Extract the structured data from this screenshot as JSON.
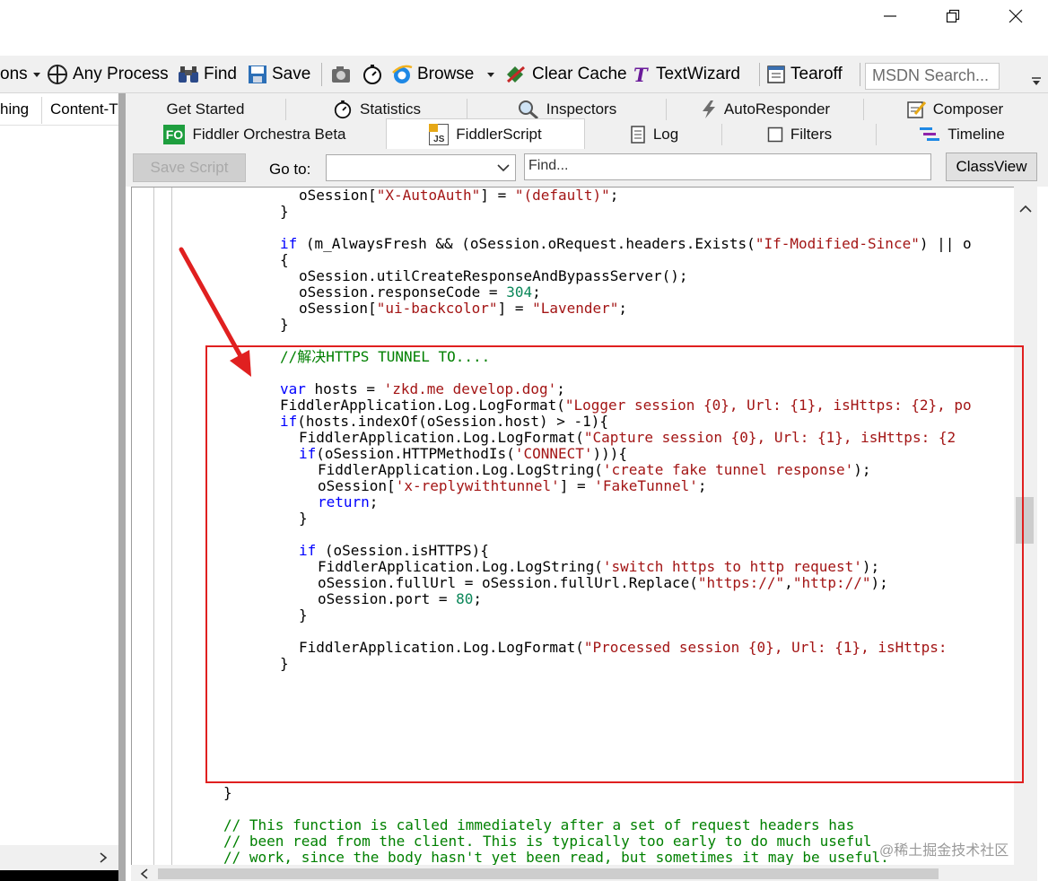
{
  "window": {
    "minimize_glyph": "—",
    "maximize_glyph": "❐",
    "close_glyph": "✕"
  },
  "toolbar": {
    "options_label": "ons",
    "any_process_label": "Any Process",
    "find_label": "Find",
    "save_label": "Save",
    "browse_label": "Browse",
    "clear_cache_label": "Clear Cache",
    "textwizard_label": "TextWizard",
    "tearoff_label": "Tearoff",
    "msdn_placeholder": "MSDN Search..."
  },
  "sessions": {
    "columns": [
      "hing",
      "Content-T"
    ]
  },
  "tabs": {
    "row1": [
      {
        "label": "Get Started",
        "icon": "none"
      },
      {
        "label": "Statistics",
        "icon": "stopwatch-icon"
      },
      {
        "label": "Inspectors",
        "icon": "inspectors-icon"
      },
      {
        "label": "AutoResponder",
        "icon": "lightning-icon"
      },
      {
        "label": "Composer",
        "icon": "composer-icon"
      }
    ],
    "row2": [
      {
        "label": "Fiddler Orchestra Beta",
        "icon": "fo-icon",
        "badge": "FO"
      },
      {
        "label": "FiddlerScript",
        "icon": "js-icon",
        "badge": "JS",
        "active": true
      },
      {
        "label": "Log",
        "icon": "log-icon"
      },
      {
        "label": "Filters",
        "icon": "checkbox-icon"
      },
      {
        "label": "Timeline",
        "icon": "timeline-icon"
      }
    ]
  },
  "script_toolbar": {
    "save_script_label": "Save Script",
    "goto_label": "Go to:",
    "find_placeholder": "Find...",
    "classview_label": "ClassView"
  },
  "code": [
    {
      "indent": 8,
      "tokens": [
        [
          "pl",
          "oSession["
        ],
        [
          "st",
          "\"X-AutoAuth\""
        ],
        [
          "pl",
          "] = "
        ],
        [
          "st",
          "\"(default)\""
        ],
        [
          "pl",
          ";"
        ]
      ]
    },
    {
      "indent": 4,
      "tokens": [
        [
          "pl",
          "}"
        ]
      ]
    },
    {
      "indent": 0,
      "tokens": []
    },
    {
      "indent": 4,
      "tokens": [
        [
          "kw",
          "if"
        ],
        [
          "pl",
          " (m_AlwaysFresh && (oSession.oRequest.headers.Exists("
        ],
        [
          "st",
          "\"If-Modified-Since\""
        ],
        [
          "pl",
          ") || o"
        ]
      ]
    },
    {
      "indent": 4,
      "tokens": [
        [
          "pl",
          "{"
        ]
      ]
    },
    {
      "indent": 8,
      "tokens": [
        [
          "pl",
          "oSession.utilCreateResponseAndBypassServer();"
        ]
      ]
    },
    {
      "indent": 8,
      "tokens": [
        [
          "pl",
          "oSession.responseCode = "
        ],
        [
          "nm",
          "304"
        ],
        [
          "pl",
          ";"
        ]
      ]
    },
    {
      "indent": 8,
      "tokens": [
        [
          "pl",
          "oSession["
        ],
        [
          "st",
          "\"ui-backcolor\""
        ],
        [
          "pl",
          "] = "
        ],
        [
          "st",
          "\"Lavender\""
        ],
        [
          "pl",
          ";"
        ]
      ]
    },
    {
      "indent": 4,
      "tokens": [
        [
          "pl",
          "}"
        ]
      ]
    },
    {
      "indent": 4,
      "tokens": [
        [
          "cm",
          "//解决HTTPS TUNNEL TO...."
        ]
      ]
    },
    {
      "indent": 0,
      "tokens": []
    },
    {
      "indent": 4,
      "tokens": [
        [
          "kw",
          "var"
        ],
        [
          "pl",
          " hosts = "
        ],
        [
          "st",
          "'zkd.me develop.dog'"
        ],
        [
          "pl",
          ";"
        ]
      ]
    },
    {
      "indent": 4,
      "tokens": [
        [
          "pl",
          "FiddlerApplication.Log.LogFormat("
        ],
        [
          "st",
          "\"Logger session {0}, Url: {1}, isHttps: {2}, po"
        ]
      ]
    },
    {
      "indent": 4,
      "tokens": [
        [
          "kw",
          "if"
        ],
        [
          "pl",
          "(hosts.indexOf(oSession.host) > -1){"
        ]
      ]
    },
    {
      "indent": 8,
      "tokens": [
        [
          "pl",
          "FiddlerApplication.Log.LogFormat("
        ],
        [
          "st",
          "\"Capture session {0}, Url: {1}, isHttps: {2"
        ]
      ]
    },
    {
      "indent": 8,
      "tokens": [
        [
          "kw",
          "if"
        ],
        [
          "pl",
          "(oSession.HTTPMethodIs("
        ],
        [
          "st",
          "'CONNECT'"
        ],
        [
          "pl",
          "))){"
        ]
      ]
    },
    {
      "indent": 12,
      "tokens": [
        [
          "pl",
          "FiddlerApplication.Log.LogString("
        ],
        [
          "st",
          "'create fake tunnel response'"
        ],
        [
          "pl",
          ");"
        ]
      ]
    },
    {
      "indent": 12,
      "tokens": [
        [
          "pl",
          "oSession["
        ],
        [
          "st",
          "'x-replywithtunnel'"
        ],
        [
          "pl",
          "] = "
        ],
        [
          "st",
          "'FakeTunnel'"
        ],
        [
          "pl",
          ";"
        ]
      ]
    },
    {
      "indent": 12,
      "tokens": [
        [
          "kw",
          "return"
        ],
        [
          "pl",
          ";"
        ]
      ]
    },
    {
      "indent": 8,
      "tokens": [
        [
          "pl",
          "}"
        ]
      ]
    },
    {
      "indent": 0,
      "tokens": []
    },
    {
      "indent": 8,
      "tokens": [
        [
          "kw",
          "if"
        ],
        [
          "pl",
          " (oSession.isHTTPS){"
        ]
      ]
    },
    {
      "indent": 12,
      "tokens": [
        [
          "pl",
          "FiddlerApplication.Log.LogString("
        ],
        [
          "st",
          "'switch https to http request'"
        ],
        [
          "pl",
          ");"
        ]
      ]
    },
    {
      "indent": 12,
      "tokens": [
        [
          "pl",
          "oSession.fullUrl = oSession.fullUrl.Replace("
        ],
        [
          "st",
          "\"https://\""
        ],
        [
          "pl",
          ","
        ],
        [
          "st",
          "\"http://\""
        ],
        [
          "pl",
          ");"
        ]
      ]
    },
    {
      "indent": 12,
      "tokens": [
        [
          "pl",
          "oSession.port = "
        ],
        [
          "nm",
          "80"
        ],
        [
          "pl",
          ";"
        ]
      ]
    },
    {
      "indent": 8,
      "tokens": [
        [
          "pl",
          "}"
        ]
      ]
    },
    {
      "indent": 0,
      "tokens": []
    },
    {
      "indent": 8,
      "tokens": [
        [
          "pl",
          "FiddlerApplication.Log.LogFormat("
        ],
        [
          "st",
          "\"Processed session {0}, Url: {1}, isHttps:"
        ]
      ]
    },
    {
      "indent": 4,
      "tokens": [
        [
          "pl",
          "}"
        ]
      ]
    },
    {
      "indent": 0,
      "tokens": [
        [
          "pl",
          "}"
        ]
      ]
    },
    {
      "indent": 0,
      "tokens": [
        [
          "cm",
          "// This function is called immediately after a set of request headers has"
        ]
      ]
    },
    {
      "indent": 0,
      "tokens": [
        [
          "cm",
          "// been read from the client. This is typically too early to do much useful"
        ]
      ]
    },
    {
      "indent": 0,
      "tokens": [
        [
          "cm",
          "// work, since the body hasn't yet been read, but sometimes it may be useful."
        ]
      ]
    }
  ],
  "watermark": "@稀土掘金技术社区",
  "colors": {
    "highlight_box": "#e02020",
    "arrow": "#e02020",
    "keyword": "#0000ff",
    "string": "#a31515",
    "comment": "#008000",
    "number": "#098658"
  }
}
